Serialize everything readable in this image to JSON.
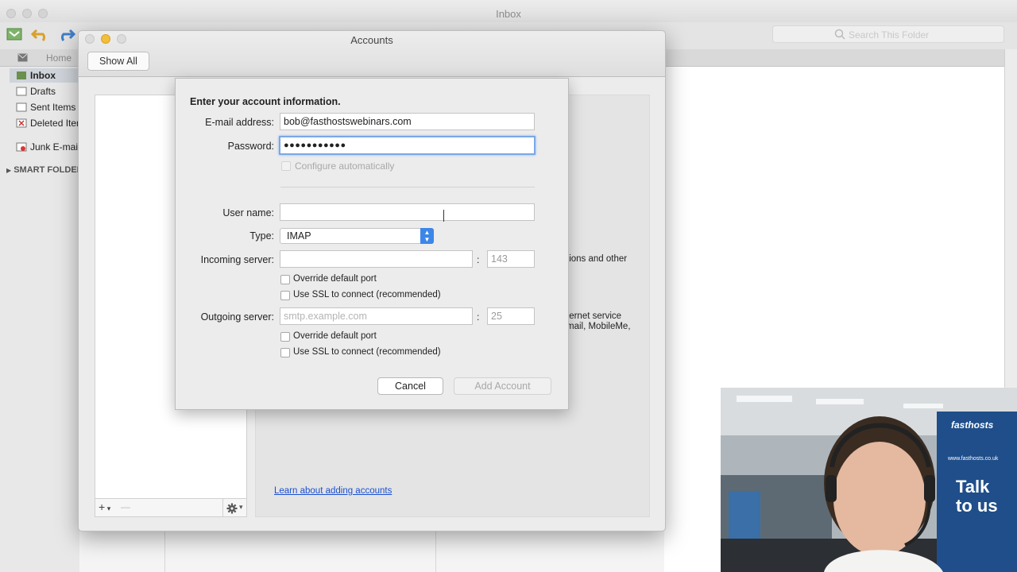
{
  "window": {
    "title": "Inbox"
  },
  "search": {
    "placeholder": "Search This Folder"
  },
  "tabs": {
    "home": "Home"
  },
  "sidebar": {
    "items": [
      {
        "label": "Inbox"
      },
      {
        "label": "Drafts"
      },
      {
        "label": "Sent Items"
      },
      {
        "label": "Deleted Items"
      },
      {
        "label": "Junk E-mail"
      }
    ],
    "smart_folders": "SMART FOLDERS"
  },
  "accounts": {
    "title": "Accounts",
    "show_all": "Show All",
    "peek_line1": "tions and other",
    "peek_line2": "ternet service",
    "peek_line3": "mail, MobileMe,",
    "learn_link": "Learn about adding accounts",
    "add_icon": "+",
    "remove_icon": "—",
    "gear_icon": "gear-icon"
  },
  "sheet": {
    "heading": "Enter your account information.",
    "email_label": "E-mail address:",
    "email_value": "bob@fasthostswebinars.com",
    "password_label": "Password:",
    "password_value": "●●●●●●●●●●●",
    "configure_label": "Configure automatically",
    "username_label": "User name:",
    "username_value": "",
    "type_label": "Type:",
    "type_value": "IMAP",
    "incoming_label": "Incoming server:",
    "incoming_value": "",
    "incoming_port": "143",
    "override_port_label": "Override default port",
    "use_ssl_label": "Use SSL to connect (recommended)",
    "outgoing_label": "Outgoing server:",
    "outgoing_placeholder": "smtp.example.com",
    "outgoing_port": "25",
    "colon": ":",
    "cancel": "Cancel",
    "add_account": "Add Account"
  },
  "webcam": {
    "banner_line1": "fasthosts",
    "banner_line2": "www.fasthosts.co.uk",
    "banner_line3": "Talk",
    "banner_line4": "to us"
  }
}
